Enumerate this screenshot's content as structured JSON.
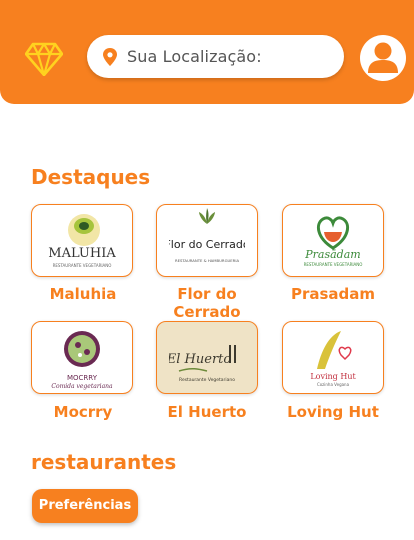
{
  "header": {
    "search_placeholder": "Sua Localização:",
    "brand_icon": "diamond-icon",
    "location_icon": "location-pin-icon",
    "profile_icon": "user-icon"
  },
  "featured": {
    "title": "Destaques",
    "items": [
      {
        "name": "Maluhia",
        "logo_text": "MALUHIA",
        "logo_sub": "RESTAURANTE VEGETARIANO"
      },
      {
        "name": "Flor do Cerrado",
        "logo_text": "Flor do Cerrado",
        "logo_sub": "RESTAURANTE & HAMBURGUERIA"
      },
      {
        "name": "Prasadam",
        "logo_text": "Prasādam",
        "logo_sub": "RESTAURANTE VEGETARIANO"
      },
      {
        "name": "Mocrry",
        "logo_text": "MOCRRY",
        "logo_sub": "Comida vegetariana"
      },
      {
        "name": "El Huerto",
        "logo_text": "El Huerto",
        "logo_sub": "Restaurante Vegetariano"
      },
      {
        "name": "Loving Hut",
        "logo_text": "Loving Hut",
        "logo_sub": "Cozinha Vegana"
      }
    ]
  },
  "restaurants": {
    "title": "restaurantes",
    "preferences_label": "Preferências"
  },
  "colors": {
    "accent": "#f7801f",
    "background": "#ffffff"
  }
}
